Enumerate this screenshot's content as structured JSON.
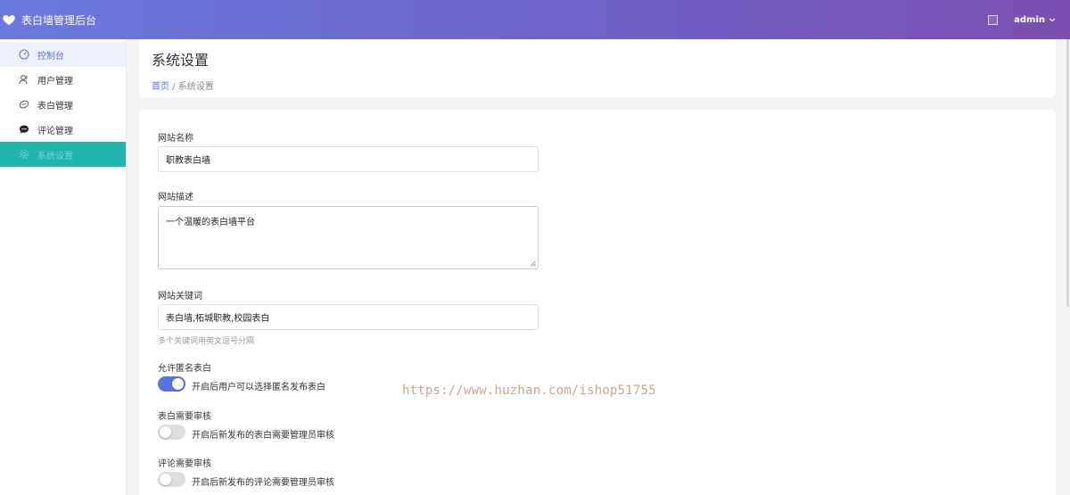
{
  "app": {
    "title": "表白墙管理后台",
    "user": "admin"
  },
  "sidebar": {
    "items": [
      {
        "label": "控制台",
        "icon": "dashboard-icon"
      },
      {
        "label": "用户管理",
        "icon": "users-icon"
      },
      {
        "label": "表白管理",
        "icon": "heart-outline-icon"
      },
      {
        "label": "评论管理",
        "icon": "comment-icon"
      },
      {
        "label": "系统设置",
        "icon": "settings-icon"
      }
    ]
  },
  "page": {
    "title": "系统设置",
    "breadcrumb": {
      "home": "首页",
      "separator": "/",
      "current": "系统设置"
    }
  },
  "form": {
    "site_name": {
      "label": "网站名称",
      "value": "职教表白墙"
    },
    "site_desc": {
      "label": "网站描述",
      "value": "一个温暖的表白墙平台"
    },
    "site_keywords": {
      "label": "网站关键词",
      "value": "表白墙,柘城职教,校园表白",
      "hint": "多个关键词用英文逗号分隔"
    },
    "allow_anonymous": {
      "label": "允许匿名表白",
      "text": "开启后用户可以选择匿名发布表白",
      "on": true
    },
    "confession_review": {
      "label": "表白需要审核",
      "text": "开启后新发布的表白需要管理员审核",
      "on": false
    },
    "comment_review": {
      "label": "评论需要审核",
      "text": "开启后新发布的评论需要管理员审核",
      "on": false
    }
  },
  "watermark": "https://www.huzhan.com/ishop51755",
  "colors": {
    "accent": "#5b73e0",
    "active_nav": "#1fb5ad",
    "header_start": "#6a79dd",
    "header_end": "#7a4fb1"
  }
}
